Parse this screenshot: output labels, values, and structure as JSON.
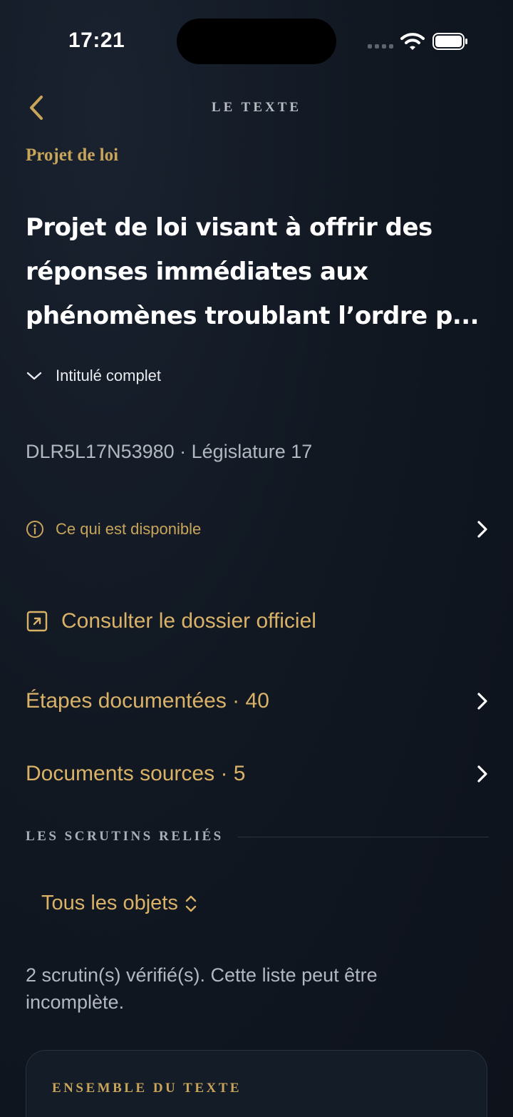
{
  "status_bar": {
    "time": "17:21"
  },
  "nav": {
    "title": "LE TEXTE",
    "back_icon": "chevron-left-icon"
  },
  "text": {
    "kind": "Projet de loi",
    "title_lines": [
      "Projet de loi visant à offrir des",
      "réponses immédiates aux",
      "phénomènes troublant l’ordre p..."
    ],
    "full_title_toggle": "Intitulé complet",
    "meta": "DLR5L17N53980 · Législature 17"
  },
  "links": {
    "available": "Ce qui est disponible",
    "official": "Consulter le dossier officiel",
    "steps": "Étapes documentées · 40",
    "sources": "Documents sources · 5"
  },
  "scrutins": {
    "section_title": "LES SCRUTINS RELIÉS",
    "filter": "Tous les objets",
    "note": "2 scrutin(s) vérifié(s). Cette liste peut être incomplète.",
    "card_title": "ENSEMBLE DU TEXTE"
  },
  "colors": {
    "accent": "#d9b268",
    "background": "#111822",
    "card": "#141c27"
  }
}
